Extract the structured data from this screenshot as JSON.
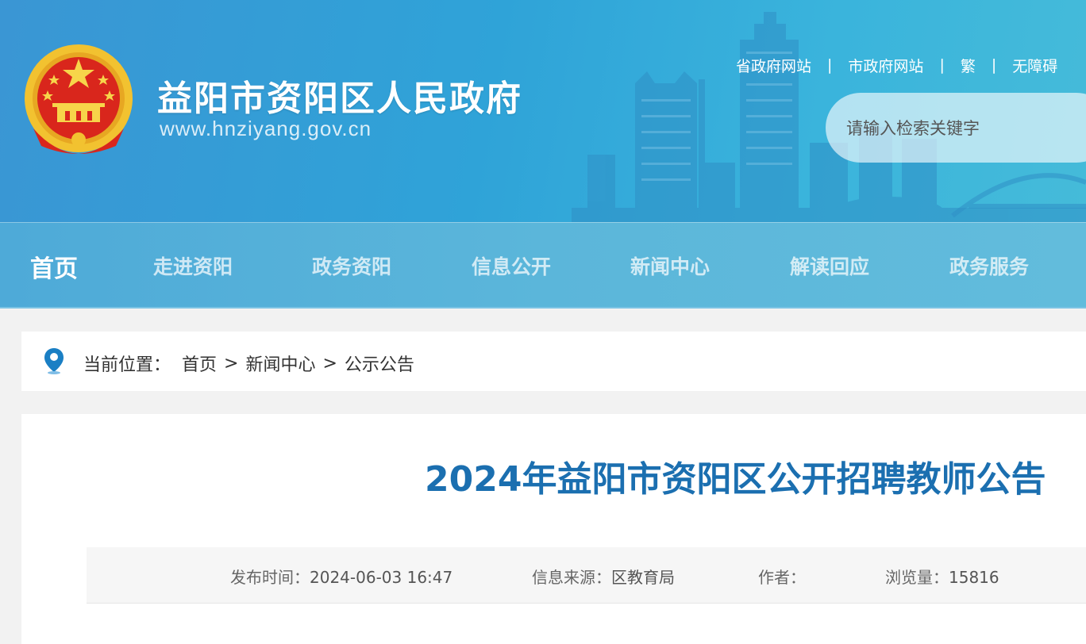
{
  "header": {
    "site_title": "益阳市资阳区人民政府",
    "site_url": "www.hnziyang.gov.cn",
    "top_links": [
      "省政府网站",
      "市政府网站",
      "繁",
      "无障碍"
    ],
    "search_placeholder": "请输入检索关键字"
  },
  "nav": {
    "items": [
      "首页",
      "走进资阳",
      "政务资阳",
      "信息公开",
      "新闻中心",
      "解读回应",
      "政务服务"
    ],
    "active": "首页"
  },
  "breadcrumb": {
    "label": "当前位置：",
    "items": [
      "首页",
      "新闻中心",
      "公示公告"
    ],
    "separator": ">"
  },
  "article": {
    "title": "2024年益阳市资阳区公开招聘教师公告",
    "meta": {
      "publish_label": "发布时间：",
      "publish_value": "2024-06-03 16:47",
      "source_label": "信息来源：",
      "source_value": "区教育局",
      "author_label": "作者：",
      "author_value": "",
      "views_label": "浏览量：",
      "views_value": "15816"
    }
  },
  "colors": {
    "header_blue": "#2fa3d8",
    "title_blue": "#1b6fb0",
    "emblem_red": "#d9261c",
    "emblem_gold": "#f2c230"
  },
  "icons": {
    "emblem": "national-emblem-icon",
    "location": "location-pin-icon"
  }
}
